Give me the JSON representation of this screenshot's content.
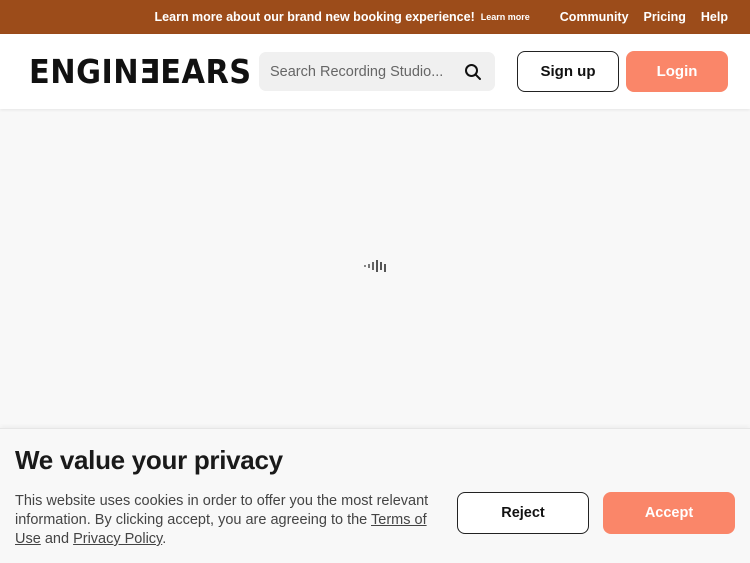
{
  "promo_bar": {
    "message": "Learn more about our brand new booking experience!",
    "learn_more": "Learn more",
    "nav": [
      "Community",
      "Pricing",
      "Help"
    ],
    "background_color": "#9c4c1a"
  },
  "header": {
    "logo": {
      "text_before": "ENGIN",
      "mirrored_letter": "E",
      "text_after": "EARS"
    },
    "search": {
      "placeholder": "Search Recording Studio...",
      "icon": "search-icon"
    },
    "signup_label": "Sign up",
    "login_label": "Login",
    "accent_color": "#fa8669"
  },
  "main": {
    "loader_icon": "loading-bars-icon"
  },
  "cookie_banner": {
    "title": "We value your privacy",
    "text": "This website uses cookies in order to offer you the most relevant information. By clicking accept, you are agreeing to the",
    "terms_link": "Terms of Use",
    "conjunction": "and",
    "privacy_link": "Privacy Policy",
    "end_punctuation": ".",
    "reject_label": "Reject",
    "accept_label": "Accept"
  }
}
